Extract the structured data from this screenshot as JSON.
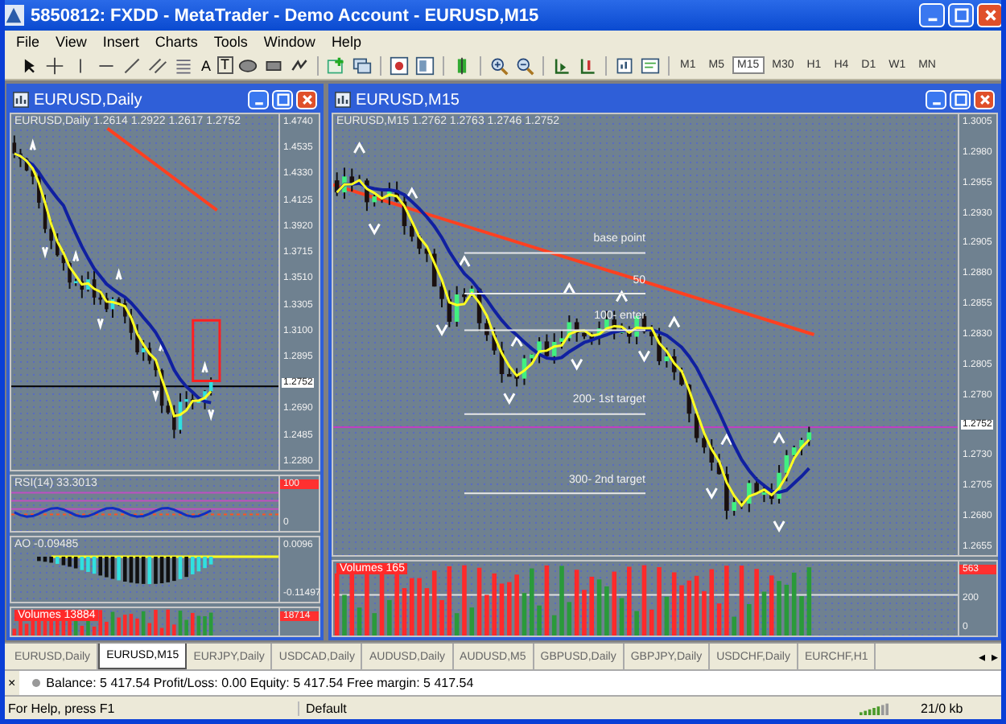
{
  "window": {
    "title": "5850812: FXDD - MetaTrader - Demo Account - EURUSD,M15"
  },
  "menu": [
    "File",
    "View",
    "Insert",
    "Charts",
    "Tools",
    "Window",
    "Help"
  ],
  "toolbar": {
    "text_tools": [
      "A",
      "T"
    ],
    "timeframes": [
      {
        "label": "M1",
        "selected": false
      },
      {
        "label": "M5",
        "selected": false
      },
      {
        "label": "M15",
        "selected": true
      },
      {
        "label": "M30",
        "selected": false
      },
      {
        "label": "H1",
        "selected": false
      },
      {
        "label": "H4",
        "selected": false
      },
      {
        "label": "D1",
        "selected": false
      },
      {
        "label": "W1",
        "selected": false
      },
      {
        "label": "MN",
        "selected": false
      }
    ]
  },
  "charts": [
    {
      "title": "EURUSD,Daily",
      "header": "EURUSD,Daily  1.2614 1.2922 1.2617 1.2752",
      "price_axis": [
        "1.4740",
        "1.4535",
        "1.4330",
        "1.4125",
        "1.3920",
        "1.3715",
        "1.3510",
        "1.3305",
        "1.3100",
        "1.2895",
        "1.2690",
        "1.2485",
        "1.2280"
      ],
      "price_tag": "1.2752",
      "panes": [
        {
          "kind": "rsi",
          "label": "RSI(14) 33.3013",
          "axis": [
            "100",
            "0"
          ]
        },
        {
          "kind": "ao",
          "label": "AO -0.09485",
          "axis": [
            "0.0096",
            "-0.11497"
          ]
        },
        {
          "kind": "volumes",
          "label": "Volumes 13884",
          "axis": [
            "18714"
          ]
        }
      ]
    },
    {
      "title": "EURUSD,M15",
      "header": "EURUSD,M15  1.2762 1.2763 1.2746 1.2752",
      "price_axis": [
        "1.3005",
        "1.2980",
        "1.2955",
        "1.2930",
        "1.2905",
        "1.2880",
        "1.2855",
        "1.2830",
        "1.2805",
        "1.2780",
        "1.2730",
        "1.2705",
        "1.2680",
        "1.2655"
      ],
      "price_tag": "1.2752",
      "annotations": [
        "base point",
        "50",
        "100- enter",
        "200- 1st target",
        "300- 2nd target"
      ],
      "panes": [
        {
          "kind": "volumes",
          "label": "Volumes 165",
          "axis": [
            "563",
            "200",
            "0"
          ]
        }
      ]
    }
  ],
  "tabs": [
    {
      "label": "EURUSD,Daily",
      "selected": false
    },
    {
      "label": "EURUSD,M15",
      "selected": true
    },
    {
      "label": "EURJPY,Daily",
      "selected": false
    },
    {
      "label": "USDCAD,Daily",
      "selected": false
    },
    {
      "label": "AUDUSD,Daily",
      "selected": false
    },
    {
      "label": "AUDUSD,M5",
      "selected": false
    },
    {
      "label": "GBPUSD,Daily",
      "selected": false
    },
    {
      "label": "GBPJPY,Daily",
      "selected": false
    },
    {
      "label": "USDCHF,Daily",
      "selected": false
    },
    {
      "label": "EURCHF,H1",
      "selected": false
    }
  ],
  "tab_scroll": [
    "◂",
    "▸"
  ],
  "terminal": {
    "close": "×",
    "text": "Balance: 5 417.54  Profit/Loss: 0.00  Equity: 5 417.54  Free margin: 5 417.54"
  },
  "status_bar": [
    "For Help, press F1",
    "Default",
    "21/0 kb"
  ]
}
